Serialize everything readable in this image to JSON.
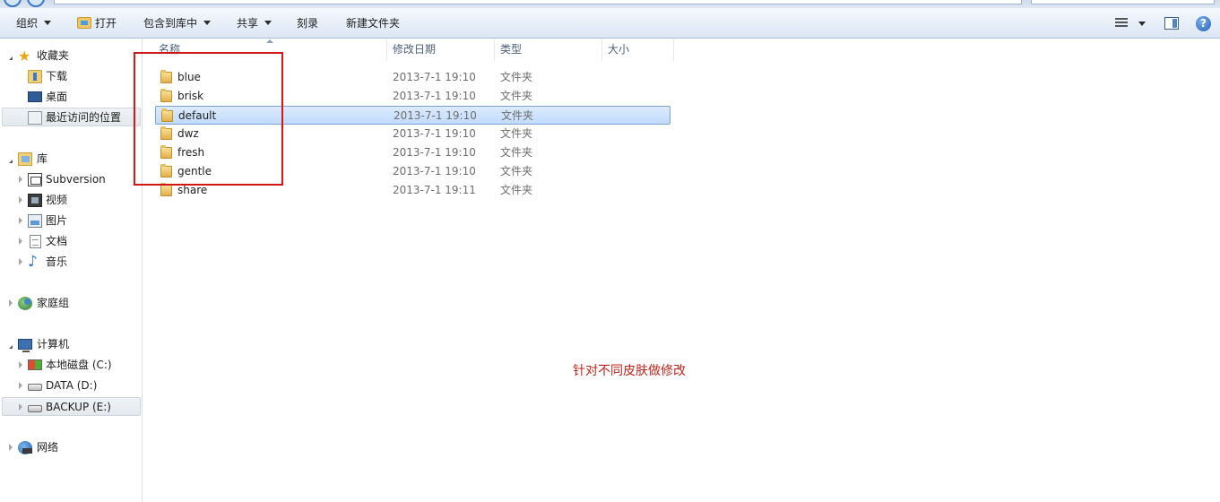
{
  "toolbar": {
    "organize": "组织",
    "open": "打开",
    "include_in_library": "包含到库中",
    "share": "共享",
    "burn": "刻录",
    "new_folder": "新建文件夹",
    "help_icon_glyph": "?"
  },
  "nav": {
    "favorites": {
      "label": "收藏夹",
      "items": [
        {
          "label": "下载",
          "icon": "download-folder-icon"
        },
        {
          "label": "桌面",
          "icon": "desktop-icon"
        },
        {
          "label": "最近访问的位置",
          "icon": "recent-places-icon",
          "selected": true
        }
      ]
    },
    "libraries": {
      "label": "库",
      "items": [
        {
          "label": "Subversion",
          "icon": "subversion-icon"
        },
        {
          "label": "视频",
          "icon": "video-icon"
        },
        {
          "label": "图片",
          "icon": "picture-icon"
        },
        {
          "label": "文档",
          "icon": "document-icon"
        },
        {
          "label": "音乐",
          "icon": "music-icon"
        }
      ]
    },
    "homegroup": {
      "label": "家庭组"
    },
    "computer": {
      "label": "计算机",
      "items": [
        {
          "label": "本地磁盘 (C:)",
          "icon": "windows-drive-icon"
        },
        {
          "label": "DATA (D:)",
          "icon": "drive-icon"
        },
        {
          "label": "BACKUP (E:)",
          "icon": "drive-icon",
          "selected": true
        }
      ]
    },
    "network": {
      "label": "网络"
    }
  },
  "columns": {
    "name": "名称",
    "modified": "修改日期",
    "type": "类型",
    "size": "大小"
  },
  "files": [
    {
      "name": "blue",
      "modified": "2013-7-1 19:10",
      "type": "文件夹"
    },
    {
      "name": "brisk",
      "modified": "2013-7-1 19:10",
      "type": "文件夹"
    },
    {
      "name": "default",
      "modified": "2013-7-1 19:10",
      "type": "文件夹",
      "selected": true
    },
    {
      "name": "dwz",
      "modified": "2013-7-1 19:10",
      "type": "文件夹"
    },
    {
      "name": "fresh",
      "modified": "2013-7-1 19:10",
      "type": "文件夹"
    },
    {
      "name": "gentle",
      "modified": "2013-7-1 19:10",
      "type": "文件夹"
    },
    {
      "name": "share",
      "modified": "2013-7-1 19:11",
      "type": "文件夹"
    }
  ],
  "annotation": {
    "note": "针对不同皮肤做修改",
    "color": "#d21717"
  },
  "colors": {
    "selection": "#c1dbfc",
    "toolbar": "#dce7f4"
  }
}
